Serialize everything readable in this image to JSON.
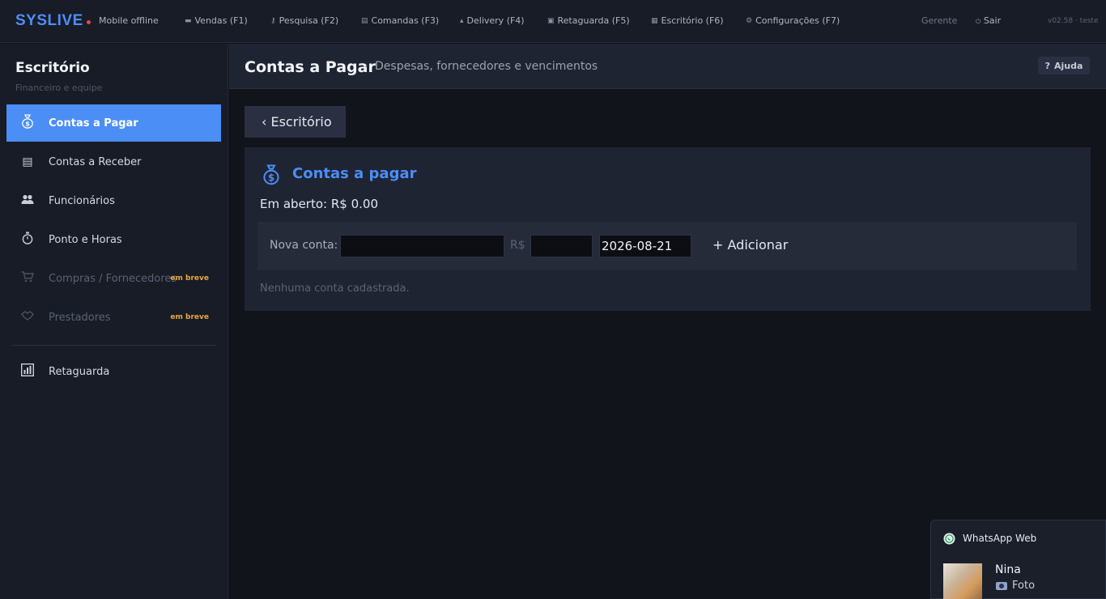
{
  "topbar": {
    "brand": "SYSLIVE",
    "status": "Mobile offline",
    "status_color": "#e5484d",
    "nav": [
      {
        "label": "Vendas (F1)",
        "icon": "cart-icon"
      },
      {
        "label": "Pesquisa (F2)",
        "icon": "key-icon"
      },
      {
        "label": "Comandas (F3)",
        "icon": "receipt-icon"
      },
      {
        "label": "Delivery (F4)",
        "icon": "scooter-icon"
      },
      {
        "label": "Retaguarda (F5)",
        "icon": "box-icon"
      },
      {
        "label": "Escritório (F6)",
        "icon": "office-icon"
      },
      {
        "label": "Configurações (F7)",
        "icon": "gear-icon"
      }
    ],
    "role": "Gerente",
    "logout": "Sair",
    "version": "v02.58 · teste"
  },
  "sidebar": {
    "title": "Escritório",
    "subtitle": "Financeiro e equipe",
    "items": [
      {
        "label": "Contas a Pagar",
        "icon": "money-bag-icon",
        "active": true
      },
      {
        "label": "Contas a Receber",
        "icon": "receipt-icon"
      },
      {
        "label": "Funcionários",
        "icon": "people-icon"
      },
      {
        "label": "Ponto e Horas",
        "icon": "stopwatch-icon"
      },
      {
        "label": "Compras / Fornecedores",
        "icon": "cart-icon",
        "badge": "em breve",
        "disabled": true
      },
      {
        "label": "Prestadores",
        "icon": "handshake-icon",
        "badge": "em breve",
        "disabled": true
      },
      {
        "label": "Retaguarda",
        "icon": "bar-chart-icon"
      }
    ]
  },
  "header": {
    "title": "Contas a Pagar",
    "separator": "·",
    "subtitle": "Despesas, fornecedores e vencimentos",
    "help": "Ajuda",
    "help_glyph": "?"
  },
  "main": {
    "back": "‹ Escritório",
    "card_title": "Contas a pagar",
    "open_label": "Em aberto: ",
    "open_value": "R$ 0.00",
    "form": {
      "label": "Nova conta:",
      "description_value": "",
      "currency": "R$",
      "amount_value": "",
      "date_value": "2026-08-21",
      "add": "+ Adicionar"
    },
    "empty": "Nenhuma conta cadastrada."
  },
  "toast": {
    "app": "WhatsApp Web",
    "contact": "Nina",
    "message": "Foto"
  },
  "colors": {
    "accent": "#4b8ef6",
    "badge": "#e7a93a"
  }
}
